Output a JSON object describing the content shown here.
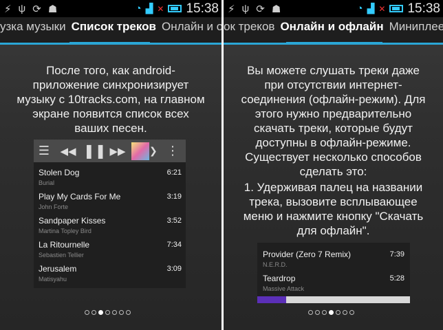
{
  "status": {
    "time": "15:38"
  },
  "left": {
    "tabs": [
      "узка музыки",
      "Список треков",
      "Онлайн и оф"
    ],
    "description": "После того, как android-приложение синхронизирует музыку с 10tracks.com, на главном экране появится список всех ваших песен.",
    "tracks": [
      {
        "title": "Stolen Dog",
        "artist": "Burial",
        "duration": "6:21"
      },
      {
        "title": "Play My Cards For Me",
        "artist": "John Forte",
        "duration": "3:19"
      },
      {
        "title": "Sandpaper Kisses",
        "artist": "Martina Topley Bird",
        "duration": "3:52"
      },
      {
        "title": "La Ritournelle",
        "artist": "Sebastien Tellier",
        "duration": "7:34"
      },
      {
        "title": "Jerusalem",
        "artist": "Matisyahu",
        "duration": "3:09"
      }
    ],
    "page_index": 2,
    "page_count": 7
  },
  "right": {
    "tabs": [
      "ок треков",
      "Онлайн и офлайн",
      "Миниплеер"
    ],
    "description_1": "Вы можете слушать треки даже при отсутствии интернет-соединения (офлайн-режим). Для этого нужно предварительно скачать треки, которые будут доступны в офлайн-режиме. Существует несколько способов сделать это:",
    "description_2": "1. Удерживая палец на названии трека, вызовите всплывающее меню и нажмите кнопку \"Скачать для офлайн\".",
    "tracks": [
      {
        "title": "Provider (Zero 7 Remix)",
        "artist": "N.E.R.D.",
        "duration": "7:39"
      },
      {
        "title": "Teardrop",
        "artist": "Massive Attack",
        "duration": "5:28"
      }
    ],
    "progress": 0.19,
    "page_index": 3,
    "page_count": 7
  }
}
